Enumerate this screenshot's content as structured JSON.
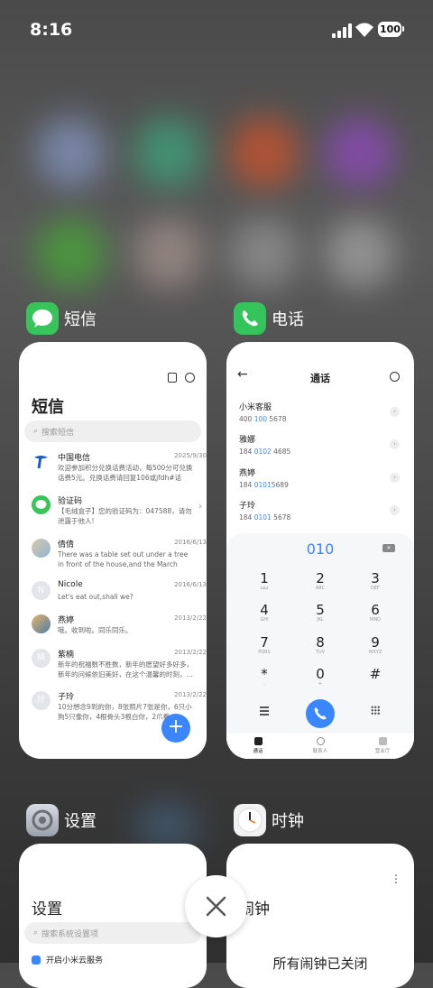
{
  "status": {
    "time": "8:16",
    "battery": "100"
  },
  "apps": {
    "messages": {
      "label": "短信",
      "title": "短信",
      "search_placeholder": "搜索短信",
      "threads": [
        {
          "name": "中国电信",
          "date": "2025/9/30",
          "preview": "欢迎参加积分兑换话费活动，每500分可兑换话费5元。兑换话费请回复106或jfdh#话费…"
        },
        {
          "name": "验证码",
          "date": "",
          "preview": "【毛绒盒子】您的验证码为：047588，请勿泄露于他人!"
        },
        {
          "name": "倩倩",
          "date": "2016/6/13",
          "preview": "There was a table set out under a tree in front of the house,and the March Hare an…"
        },
        {
          "name": "Nicole",
          "date": "2016/6/13",
          "preview": "Let's eat out,shall we?"
        },
        {
          "name": "燕婷",
          "date": "2013/2/22",
          "preview": "哦。收到啦。同乐同乐。"
        },
        {
          "name": "紫楠",
          "date": "2013/2/22",
          "preview": "新年的祝福数不胜数，新年的愿望好多好多，新年的问候依旧美好，在这个温馨的时刻，…"
        },
        {
          "name": "子玲",
          "date": "2013/2/22",
          "preview": "10分想念9到的你，8张照片7张是你，6只小狗5只像你，4根骨头3根白你，2爪看…"
        }
      ],
      "avatar_letters": {
        "nicole": "N",
        "zinan": "楠",
        "ziling": "玲"
      },
      "fab": "+"
    },
    "phone": {
      "label": "电话",
      "title": "通话",
      "back": "←",
      "contacts": [
        {
          "name": "小米客服",
          "pre": "400 ",
          "hl": "100",
          "post": " 5678"
        },
        {
          "name": "雅娜",
          "pre": "184 ",
          "hl": "0102",
          "post": " 4685"
        },
        {
          "name": "燕婷",
          "pre": "184 ",
          "hl": "0101",
          "post": "5689"
        },
        {
          "name": "子玲",
          "pre": "184 ",
          "hl": "0101",
          "post": " 5678"
        }
      ],
      "dialed": "010",
      "keys": [
        {
          "d": "1",
          "l": "ωω"
        },
        {
          "d": "2",
          "l": "ABC"
        },
        {
          "d": "3",
          "l": "DEF"
        },
        {
          "d": "4",
          "l": "GHI"
        },
        {
          "d": "5",
          "l": "JKL"
        },
        {
          "d": "6",
          "l": "MNO"
        },
        {
          "d": "7",
          "l": "PQRS"
        },
        {
          "d": "8",
          "l": "TUV"
        },
        {
          "d": "9",
          "l": "WXYZ"
        },
        {
          "d": "*",
          "l": ","
        },
        {
          "d": "0",
          "l": "+"
        },
        {
          "d": "#",
          "l": ""
        }
      ],
      "tabs": [
        "通话",
        "联系人",
        "营业厅"
      ]
    },
    "settings": {
      "label": "设置",
      "title": "设置",
      "search_placeholder": "搜索系统设置项",
      "first_item": "开启小米云服务"
    },
    "clock": {
      "label": "时钟",
      "title": "闹钟",
      "empty_text": "所有闹钟已关闭",
      "menu": "⋮"
    }
  },
  "colors": {
    "accent": "#3a86ff",
    "messages_icon": "#37c459",
    "phone_icon": "#33c45b"
  }
}
